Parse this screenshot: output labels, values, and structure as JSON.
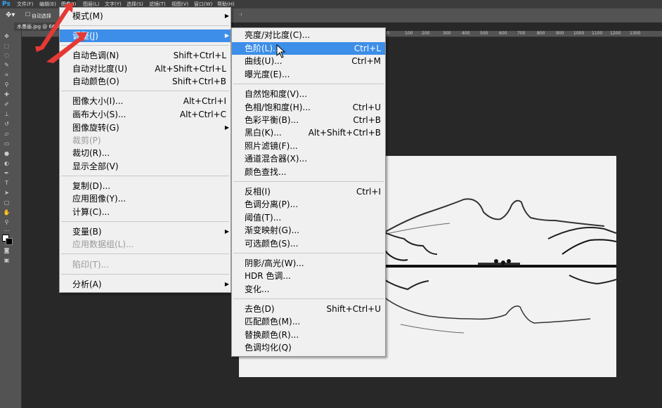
{
  "menubar": {
    "logo": "Ps",
    "items": [
      "文件(F)",
      "编辑(E)",
      "图像(I)",
      "图层(L)",
      "文字(Y)",
      "选择(S)",
      "滤镜(T)",
      "视图(V)",
      "窗口(W)",
      "帮助(H)"
    ]
  },
  "options": {
    "auto_select": "自动选择"
  },
  "document": {
    "tab_title": "水墨画.jpg @ 66.7%"
  },
  "ruler": {
    "ticks": [
      "100",
      "0",
      "100",
      "200",
      "300",
      "400",
      "500",
      "600",
      "700",
      "800",
      "900",
      "1000",
      "1100",
      "1200",
      "1300"
    ]
  },
  "image_menu": {
    "mode": "模式(M)",
    "adjust": "调整(J)",
    "auto_tone": {
      "label": "自动色调(N)",
      "shortcut": "Shift+Ctrl+L"
    },
    "auto_contrast": {
      "label": "自动对比度(U)",
      "shortcut": "Alt+Shift+Ctrl+L"
    },
    "auto_color": {
      "label": "自动颜色(O)",
      "shortcut": "Shift+Ctrl+B"
    },
    "image_size": {
      "label": "图像大小(I)...",
      "shortcut": "Alt+Ctrl+I"
    },
    "canvas_size": {
      "label": "画布大小(S)...",
      "shortcut": "Alt+Ctrl+C"
    },
    "image_rotation": "图像旋转(G)",
    "crop": "裁剪(P)",
    "trim": "裁切(R)...",
    "reveal_all": "显示全部(V)",
    "duplicate": "复制(D)...",
    "apply_image": "应用图像(Y)...",
    "calculations": "计算(C)...",
    "variables": "变量(B)",
    "apply_data_set": "应用数据组(L)...",
    "trap": "陷印(T)...",
    "analysis": "分析(A)"
  },
  "adjust_menu": {
    "brightness_contrast": {
      "label": "亮度/对比度(C)..."
    },
    "levels": {
      "label": "色阶(L)...",
      "shortcut": "Ctrl+L"
    },
    "curves": {
      "label": "曲线(U)...",
      "shortcut": "Ctrl+M"
    },
    "exposure": {
      "label": "曝光度(E)..."
    },
    "vibrance": {
      "label": "自然饱和度(V)..."
    },
    "hue_saturation": {
      "label": "色相/饱和度(H)...",
      "shortcut": "Ctrl+U"
    },
    "color_balance": {
      "label": "色彩平衡(B)...",
      "shortcut": "Ctrl+B"
    },
    "black_white": {
      "label": "黑白(K)...",
      "shortcut": "Alt+Shift+Ctrl+B"
    },
    "photo_filter": {
      "label": "照片滤镜(F)..."
    },
    "channel_mixer": {
      "label": "通道混合器(X)..."
    },
    "color_lookup": {
      "label": "颜色查找..."
    },
    "invert": {
      "label": "反相(I)",
      "shortcut": "Ctrl+I"
    },
    "posterize": {
      "label": "色调分离(P)..."
    },
    "threshold": {
      "label": "阈值(T)..."
    },
    "gradient_map": {
      "label": "渐变映射(G)..."
    },
    "selective_color": {
      "label": "可选颜色(S)..."
    },
    "shadows_highlights": {
      "label": "阴影/高光(W)..."
    },
    "hdr_toning": {
      "label": "HDR 色调..."
    },
    "variations": {
      "label": "变化..."
    },
    "desaturate": {
      "label": "去色(D)",
      "shortcut": "Shift+Ctrl+U"
    },
    "match_color": {
      "label": "匹配颜色(M)..."
    },
    "replace_color": {
      "label": "替换颜色(R)..."
    },
    "equalize": {
      "label": "色调均化(Q)"
    }
  },
  "colors": {
    "highlight": "#3d8ee8",
    "annotation_arrow": "#e53935",
    "menu_bg": "#f0f0f0"
  }
}
